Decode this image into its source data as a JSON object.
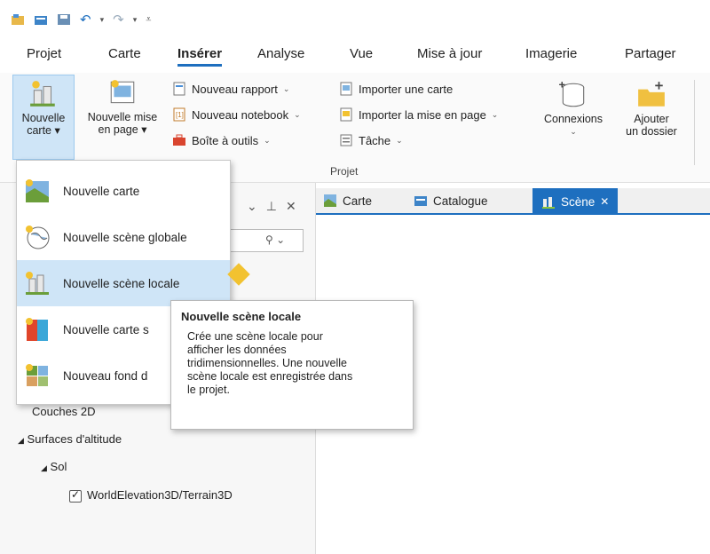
{
  "qat": {
    "icons": [
      "new-project-icon",
      "open-project-icon",
      "save-project-icon",
      "undo-icon",
      "redo-icon",
      "customize-qat-icon"
    ]
  },
  "tabs": [
    "Projet",
    "Carte",
    "Insérer",
    "Analyse",
    "Vue",
    "Mise à jour",
    "Imagerie",
    "Partager"
  ],
  "active_tab": "Insérer",
  "ribbon": {
    "nouvelle_carte": {
      "line1": "Nouvelle",
      "line2": "carte ▾"
    },
    "nouvelle_mise": {
      "line1": "Nouvelle mise",
      "line2": "en page ▾"
    },
    "nouveau_rapport": "Nouveau rapport",
    "nouveau_notebook": "Nouveau notebook",
    "boite_outils": "Boîte à outils",
    "importer_carte": "Importer une carte",
    "importer_mise": "Importer la mise en page",
    "tache": "Tâche",
    "connexions": "Connexions",
    "ajouter_dossier": {
      "line1": "Ajouter",
      "line2": "un dossier"
    },
    "group_label": "Projet"
  },
  "dropdown": {
    "items": [
      {
        "label": "Nouvelle carte",
        "icon": "new-map-icon"
      },
      {
        "label": "Nouvelle scène globale",
        "icon": "global-scene-icon"
      },
      {
        "label": "Nouvelle scène locale",
        "icon": "local-scene-icon"
      },
      {
        "label": "Nouvelle carte s",
        "icon": "stereo-map-icon"
      },
      {
        "label": "Nouveau fond d",
        "icon": "basemap-icon"
      }
    ],
    "selected_index": 2
  },
  "tooltip": {
    "title": "Nouvelle scène locale",
    "body": "Crée une scène locale pour afficher les données tridimensionnelles. Une nouvelle scène locale est enregistrée dans le projet."
  },
  "doc_tabs": [
    "Carte",
    "Catalogue",
    "Scène"
  ],
  "active_doc_tab": "Scène",
  "tree": {
    "couches_2d": "Couches 2D",
    "surfaces": "Surfaces d'altitude",
    "sol": "Sol",
    "terrain": "WorldElevation3D/Terrain3D"
  },
  "colors": {
    "accent": "#1e6fbf",
    "selection": "#cfe5f7"
  }
}
